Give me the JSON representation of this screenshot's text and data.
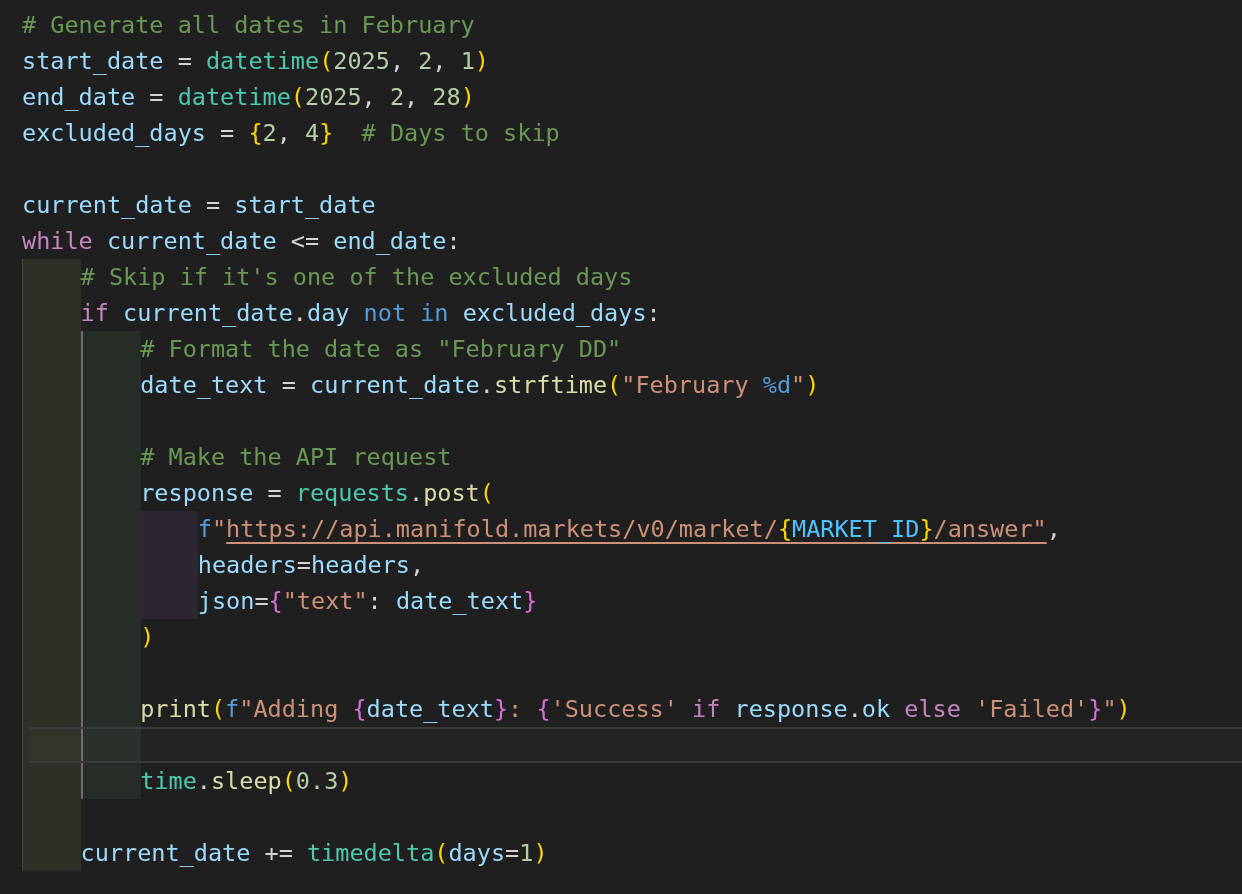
{
  "editor": {
    "lines": [
      {
        "kind": "code",
        "current": false,
        "tokens": [
          {
            "kind": "cm",
            "text": "# Generate all dates in February"
          }
        ]
      },
      {
        "kind": "code",
        "current": false,
        "tokens": [
          {
            "kind": "var",
            "text": "start_date"
          },
          {
            "kind": "op",
            "text": " = "
          },
          {
            "kind": "cls",
            "text": "datetime"
          },
          {
            "kind": "b1",
            "text": "("
          },
          {
            "kind": "num",
            "text": "2025"
          },
          {
            "kind": "op",
            "text": ", "
          },
          {
            "kind": "num",
            "text": "2"
          },
          {
            "kind": "op",
            "text": ", "
          },
          {
            "kind": "num",
            "text": "1"
          },
          {
            "kind": "b1",
            "text": ")"
          }
        ]
      },
      {
        "kind": "code",
        "current": false,
        "tokens": [
          {
            "kind": "var",
            "text": "end_date"
          },
          {
            "kind": "op",
            "text": " = "
          },
          {
            "kind": "cls",
            "text": "datetime"
          },
          {
            "kind": "b1",
            "text": "("
          },
          {
            "kind": "num",
            "text": "2025"
          },
          {
            "kind": "op",
            "text": ", "
          },
          {
            "kind": "num",
            "text": "2"
          },
          {
            "kind": "op",
            "text": ", "
          },
          {
            "kind": "num",
            "text": "28"
          },
          {
            "kind": "b1",
            "text": ")"
          }
        ]
      },
      {
        "kind": "code",
        "current": false,
        "tokens": [
          {
            "kind": "var",
            "text": "excluded_days"
          },
          {
            "kind": "op",
            "text": " = "
          },
          {
            "kind": "b1",
            "text": "{"
          },
          {
            "kind": "num",
            "text": "2"
          },
          {
            "kind": "op",
            "text": ", "
          },
          {
            "kind": "num",
            "text": "4"
          },
          {
            "kind": "b1",
            "text": "}"
          },
          {
            "kind": "cm",
            "text": "  # Days to skip"
          }
        ]
      },
      {
        "kind": "blank",
        "current": false
      },
      {
        "kind": "code",
        "current": false,
        "tokens": [
          {
            "kind": "var",
            "text": "current_date"
          },
          {
            "kind": "op",
            "text": " = "
          },
          {
            "kind": "var",
            "text": "start_date"
          }
        ]
      },
      {
        "kind": "code",
        "current": false,
        "tokens": [
          {
            "kind": "kw",
            "text": "while"
          },
          {
            "kind": "var",
            "text": " current_date"
          },
          {
            "kind": "op",
            "text": " <= "
          },
          {
            "kind": "var",
            "text": "end_date"
          },
          {
            "kind": "op",
            "text": ":"
          }
        ],
        "children": [
          {
            "kind": "code",
            "current": false,
            "tokens": [
              {
                "kind": "cm",
                "text": "# Skip if it's one of the excluded days"
              }
            ]
          },
          {
            "kind": "code",
            "current": false,
            "tokens": [
              {
                "kind": "kw",
                "text": "if"
              },
              {
                "kind": "var",
                "text": " current_date"
              },
              {
                "kind": "op",
                "text": "."
              },
              {
                "kind": "var",
                "text": "day"
              },
              {
                "kind": "okw",
                "text": " not"
              },
              {
                "kind": "okw",
                "text": " in"
              },
              {
                "kind": "var",
                "text": " excluded_days"
              },
              {
                "kind": "op",
                "text": ":"
              }
            ],
            "children": [
              {
                "kind": "code",
                "current": false,
                "tokens": [
                  {
                    "kind": "cm",
                    "text": "# Format the date as \"February DD\""
                  }
                ]
              },
              {
                "kind": "code",
                "current": false,
                "tokens": [
                  {
                    "kind": "var",
                    "text": "date_text"
                  },
                  {
                    "kind": "op",
                    "text": " = "
                  },
                  {
                    "kind": "var",
                    "text": "current_date"
                  },
                  {
                    "kind": "op",
                    "text": "."
                  },
                  {
                    "kind": "fn",
                    "text": "strftime"
                  },
                  {
                    "kind": "b1",
                    "text": "("
                  },
                  {
                    "kind": "str",
                    "text": "\"February "
                  },
                  {
                    "kind": "fmt",
                    "text": "%d"
                  },
                  {
                    "kind": "str",
                    "text": "\""
                  },
                  {
                    "kind": "b1",
                    "text": ")"
                  }
                ]
              },
              {
                "kind": "blank",
                "current": false
              },
              {
                "kind": "code",
                "current": false,
                "tokens": [
                  {
                    "kind": "cm",
                    "text": "# Make the API request"
                  }
                ]
              },
              {
                "kind": "code",
                "current": false,
                "tokens": [
                  {
                    "kind": "var",
                    "text": "response"
                  },
                  {
                    "kind": "op",
                    "text": " = "
                  },
                  {
                    "kind": "cls",
                    "text": "requests"
                  },
                  {
                    "kind": "op",
                    "text": "."
                  },
                  {
                    "kind": "fn",
                    "text": "post"
                  },
                  {
                    "kind": "b1",
                    "text": "("
                  }
                ],
                "children": [
                  {
                    "kind": "code",
                    "current": false,
                    "tokens": [
                      {
                        "kind": "fpre",
                        "text": "f"
                      },
                      {
                        "kind": "str",
                        "text": "\""
                      },
                      {
                        "kind": "url",
                        "text": "https://api.manifold.markets/v0/market/"
                      },
                      {
                        "kind": "urlb",
                        "text": "{"
                      },
                      {
                        "kind": "urlc",
                        "text": "MARKET_ID"
                      },
                      {
                        "kind": "urlb",
                        "text": "}"
                      },
                      {
                        "kind": "url",
                        "text": "/answer\""
                      },
                      {
                        "kind": "op",
                        "text": ","
                      }
                    ]
                  },
                  {
                    "kind": "code",
                    "current": false,
                    "tokens": [
                      {
                        "kind": "var",
                        "text": "headers"
                      },
                      {
                        "kind": "op",
                        "text": "="
                      },
                      {
                        "kind": "var",
                        "text": "headers"
                      },
                      {
                        "kind": "op",
                        "text": ","
                      }
                    ]
                  },
                  {
                    "kind": "code",
                    "current": false,
                    "tokens": [
                      {
                        "kind": "var",
                        "text": "json"
                      },
                      {
                        "kind": "op",
                        "text": "="
                      },
                      {
                        "kind": "b2",
                        "text": "{"
                      },
                      {
                        "kind": "str",
                        "text": "\"text\""
                      },
                      {
                        "kind": "op",
                        "text": ": "
                      },
                      {
                        "kind": "var",
                        "text": "date_text"
                      },
                      {
                        "kind": "b2",
                        "text": "}"
                      }
                    ]
                  }
                ]
              },
              {
                "kind": "code",
                "current": false,
                "tokens": [
                  {
                    "kind": "b1",
                    "text": ")"
                  }
                ]
              },
              {
                "kind": "blank",
                "current": false
              },
              {
                "kind": "code",
                "current": false,
                "tokens": [
                  {
                    "kind": "fn",
                    "text": "print"
                  },
                  {
                    "kind": "b1",
                    "text": "("
                  },
                  {
                    "kind": "fpre",
                    "text": "f"
                  },
                  {
                    "kind": "str",
                    "text": "\"Adding "
                  },
                  {
                    "kind": "b2",
                    "text": "{"
                  },
                  {
                    "kind": "var",
                    "text": "date_text"
                  },
                  {
                    "kind": "b2",
                    "text": "}"
                  },
                  {
                    "kind": "str",
                    "text": ": "
                  },
                  {
                    "kind": "b2",
                    "text": "{"
                  },
                  {
                    "kind": "str",
                    "text": "'Success'"
                  },
                  {
                    "kind": "kw",
                    "text": " if"
                  },
                  {
                    "kind": "var",
                    "text": " response"
                  },
                  {
                    "kind": "op",
                    "text": "."
                  },
                  {
                    "kind": "var",
                    "text": "ok"
                  },
                  {
                    "kind": "kw",
                    "text": " else"
                  },
                  {
                    "kind": "str",
                    "text": " 'Failed'"
                  },
                  {
                    "kind": "b2",
                    "text": "}"
                  },
                  {
                    "kind": "str",
                    "text": "\""
                  },
                  {
                    "kind": "b1",
                    "text": ")"
                  }
                ]
              },
              {
                "kind": "blank",
                "current": true
              },
              {
                "kind": "code",
                "current": false,
                "tokens": [
                  {
                    "kind": "cls",
                    "text": "time"
                  },
                  {
                    "kind": "op",
                    "text": "."
                  },
                  {
                    "kind": "fn",
                    "text": "sleep"
                  },
                  {
                    "kind": "b1",
                    "text": "("
                  },
                  {
                    "kind": "num",
                    "text": "0.3"
                  },
                  {
                    "kind": "b1",
                    "text": ")"
                  }
                ]
              }
            ]
          },
          {
            "kind": "blank",
            "current": false
          },
          {
            "kind": "code",
            "current": false,
            "tokens": [
              {
                "kind": "var",
                "text": "current_date"
              },
              {
                "kind": "op",
                "text": " += "
              },
              {
                "kind": "cls",
                "text": "timedelta"
              },
              {
                "kind": "b1",
                "text": "("
              },
              {
                "kind": "var",
                "text": "days"
              },
              {
                "kind": "op",
                "text": "="
              },
              {
                "kind": "num",
                "text": "1"
              },
              {
                "kind": "b1",
                "text": ")"
              }
            ]
          }
        ]
      }
    ]
  }
}
